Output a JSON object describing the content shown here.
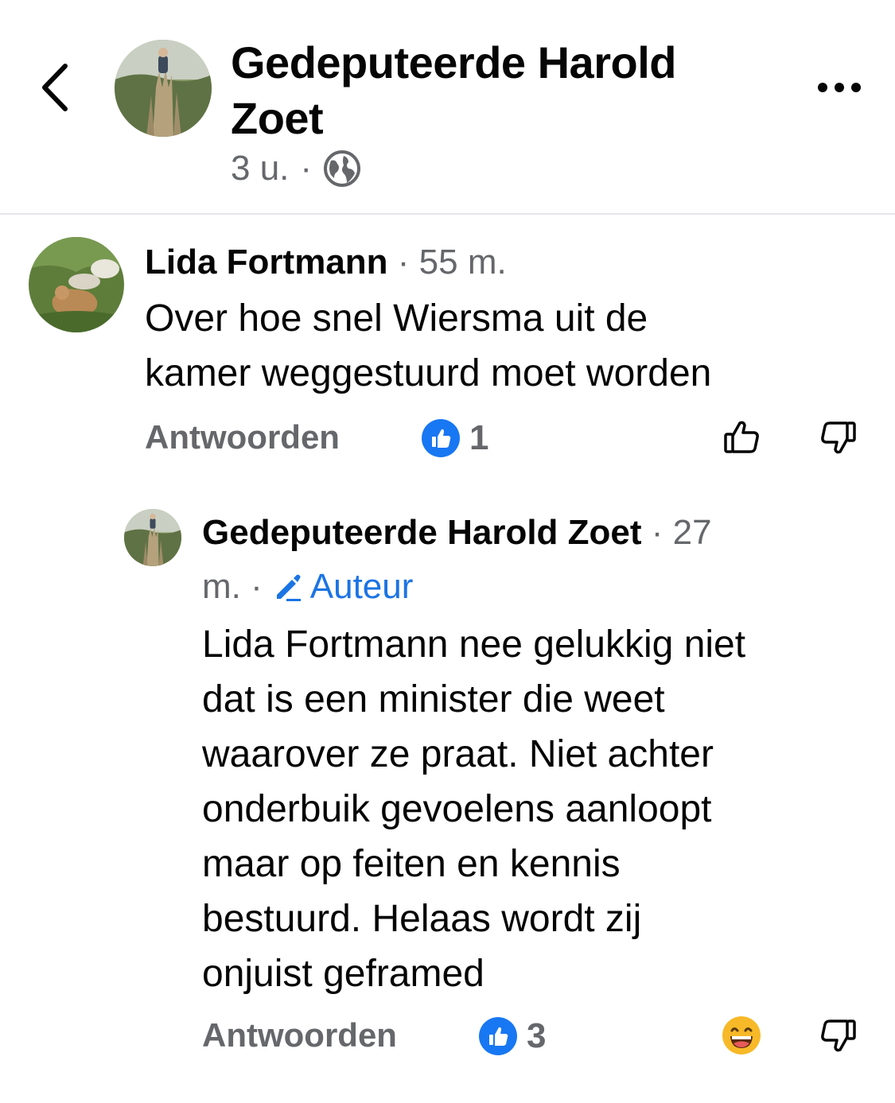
{
  "header": {
    "title": "Gedeputeerde Harold Zoet",
    "time": "3 u.",
    "separator": "·"
  },
  "comments": [
    {
      "author": "Lida Fortmann",
      "time": "· 55 m.",
      "text_lines": [
        "Over hoe snel Wiersma uit de",
        "kamer weggestuurd moet worden"
      ],
      "reply_label": "Antwoorden",
      "reaction_count": "1"
    },
    {
      "author": "Gedeputeerde Harold Zoet",
      "time_part1": "· 27",
      "time_part2": "m. ·",
      "badge": "Auteur",
      "text_lines": [
        "Lida Fortmann nee gelukkig niet",
        "dat is een minister die weet",
        "waarover ze praat. Niet achter",
        "onderbuik gevoelens aanloopt",
        "maar op feiten en kennis",
        "bestuurd. Helaas wordt zij",
        "onjuist geframed"
      ],
      "reply_label": "Antwoorden",
      "reaction_count": "3"
    }
  ],
  "colors": {
    "accent": "#1877f2",
    "secondary_text": "#65676b",
    "author_badge": "#1b74e4"
  },
  "icons": [
    "chevron-left-icon",
    "globe-icon",
    "more-icon",
    "like-icon",
    "thumbs-up-outline-icon",
    "thumbs-down-outline-icon",
    "laughing-emoji-icon",
    "pencil-icon"
  ]
}
